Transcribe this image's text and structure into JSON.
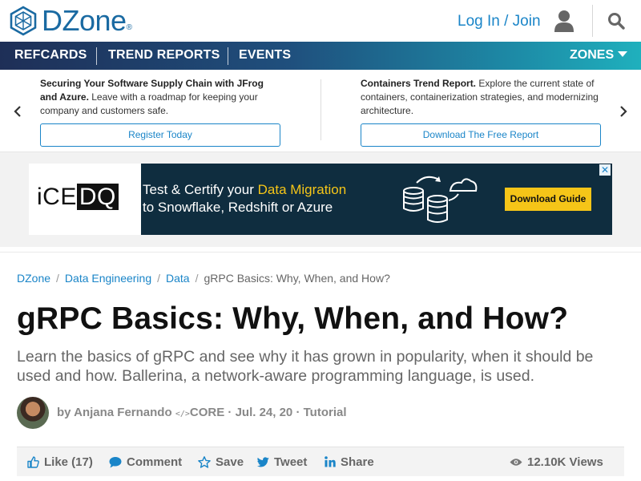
{
  "header": {
    "logo_text": "DZone",
    "logo_registered": "®",
    "login_label": "Log In / Join"
  },
  "nav": {
    "items": [
      "REFCARDS",
      "TREND REPORTS",
      "EVENTS"
    ],
    "zones_label": "ZONES"
  },
  "promos": [
    {
      "title": "Securing Your Software Supply Chain with JFrog and Azure.",
      "body": "Leave with a roadmap for keeping your company and customers safe.",
      "button": "Register Today"
    },
    {
      "title": "Containers Trend Report.",
      "body": "Explore the current state of containers, containerization strategies, and modernizing architecture.",
      "button": "Download The Free Report"
    }
  ],
  "ad": {
    "logo_prefix": "iCE",
    "logo_suffix": "DQ",
    "line1_pre": "Test & Certify your ",
    "line1_highlight": "Data Migration",
    "line2": "to Snowflake, Redshift or Azure",
    "cta": "Download Guide",
    "close": "✕"
  },
  "breadcrumb": {
    "items": [
      "DZone",
      "Data Engineering",
      "Data"
    ],
    "current": "gRPC Basics: Why, When, and How?"
  },
  "article": {
    "title": "gRPC Basics: Why, When, and How?",
    "subtitle": "Learn the basics of gRPC and see why it has grown in popularity, when it should be used and how. Ballerina, a network-aware programming language, is used.",
    "byline_prefix": "by ",
    "author": "Anjana Fernando",
    "core_glyph": "</>",
    "core_label": "CORE",
    "sep1": " · ",
    "date": "Jul. 24, 20",
    "sep2": " · ",
    "type": "Tutorial"
  },
  "actions": {
    "like": "Like (17)",
    "comment": "Comment",
    "save": "Save",
    "tweet": "Tweet",
    "share": "Share",
    "views": "12.10K Views"
  },
  "colors": {
    "brand_blue": "#1a6aa2",
    "link_blue": "#1a85c8",
    "ad_bg": "#0f2d3f",
    "ad_accent": "#f5c518"
  }
}
